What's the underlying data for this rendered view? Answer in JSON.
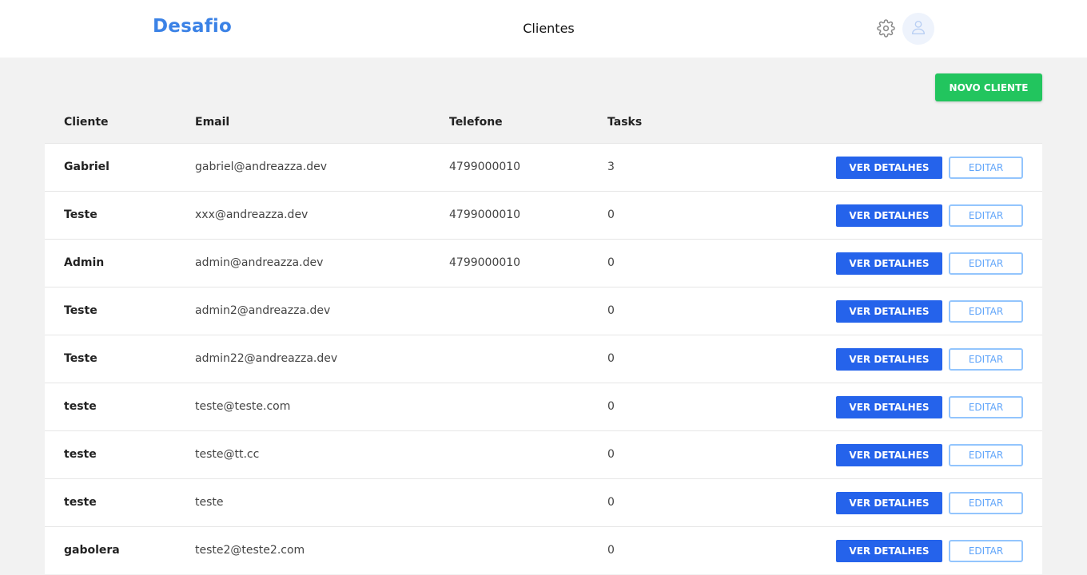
{
  "header": {
    "brand": "Desafio",
    "title": "Clientes",
    "settings_icon": "gear-icon",
    "avatar_icon": "user-icon"
  },
  "actions": {
    "new_client_label": "NOVO CLIENTE"
  },
  "table": {
    "columns": [
      "Cliente",
      "Email",
      "Telefone",
      "Tasks"
    ],
    "details_label": "VER DETALHES",
    "edit_label": "EDITAR",
    "rows": [
      {
        "name": "Gabriel",
        "email": "gabriel@andreazza.dev",
        "phone": "4799000010",
        "tasks": "3"
      },
      {
        "name": "Teste",
        "email": "xxx@andreazza.dev",
        "phone": "4799000010",
        "tasks": "0"
      },
      {
        "name": "Admin",
        "email": "admin@andreazza.dev",
        "phone": "4799000010",
        "tasks": "0"
      },
      {
        "name": "Teste",
        "email": "admin2@andreazza.dev",
        "phone": "",
        "tasks": "0"
      },
      {
        "name": "Teste",
        "email": "admin22@andreazza.dev",
        "phone": "",
        "tasks": "0"
      },
      {
        "name": "teste",
        "email": "teste@teste.com",
        "phone": "",
        "tasks": "0"
      },
      {
        "name": "teste",
        "email": "teste@tt.cc",
        "phone": "",
        "tasks": "0"
      },
      {
        "name": "teste",
        "email": "teste",
        "phone": "",
        "tasks": "0"
      },
      {
        "name": "gabolera",
        "email": "teste2@teste2.com",
        "phone": "",
        "tasks": "0"
      }
    ]
  },
  "colors": {
    "brand": "#3b82e6",
    "primary": "#2563eb",
    "success": "#22c55e",
    "outline": "#93c5fd"
  }
}
